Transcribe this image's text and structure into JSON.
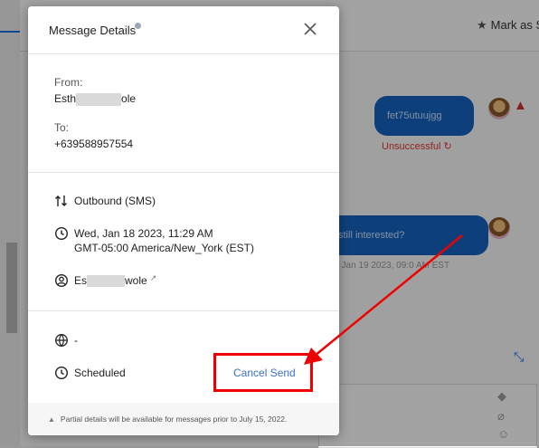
{
  "background": {
    "header": {
      "mark_as_label": "Mark as S"
    },
    "messages": [
      {
        "text": "fet75utuujgg",
        "status": "Unsuccessful"
      },
      {
        "text": "still interested?",
        "timestamp": ", Jan 19 2023, 09:0  AM EST"
      }
    ]
  },
  "modal": {
    "title": "Message Details",
    "from_label": "From:",
    "from_name_start": "Esth",
    "from_name_end": "ole",
    "to_label": "To:",
    "to_number": "+639588957554",
    "direction": "Outbound (SMS)",
    "datetime_line1": "Wed, Jan 18 2023, 11:29 AM",
    "datetime_line2": "GMT-05:00 America/New_York (EST)",
    "user_name_start": "Es",
    "user_name_end": "wole",
    "channel_value": "-",
    "status": "Scheduled",
    "cancel_label": "Cancel Send",
    "footer_note": "Partial details will be available for messages prior to July 15, 2022."
  },
  "colors": {
    "accent": "#3d6fc7",
    "annotation": "#e00000",
    "error": "#e53935",
    "bubble": "#1565c0"
  },
  "icons": [
    "info-icon",
    "close-icon",
    "direction-arrows-icon",
    "clock-icon",
    "user-circle-icon",
    "external-link-icon",
    "globe-icon",
    "warning-icon",
    "star-icon"
  ]
}
